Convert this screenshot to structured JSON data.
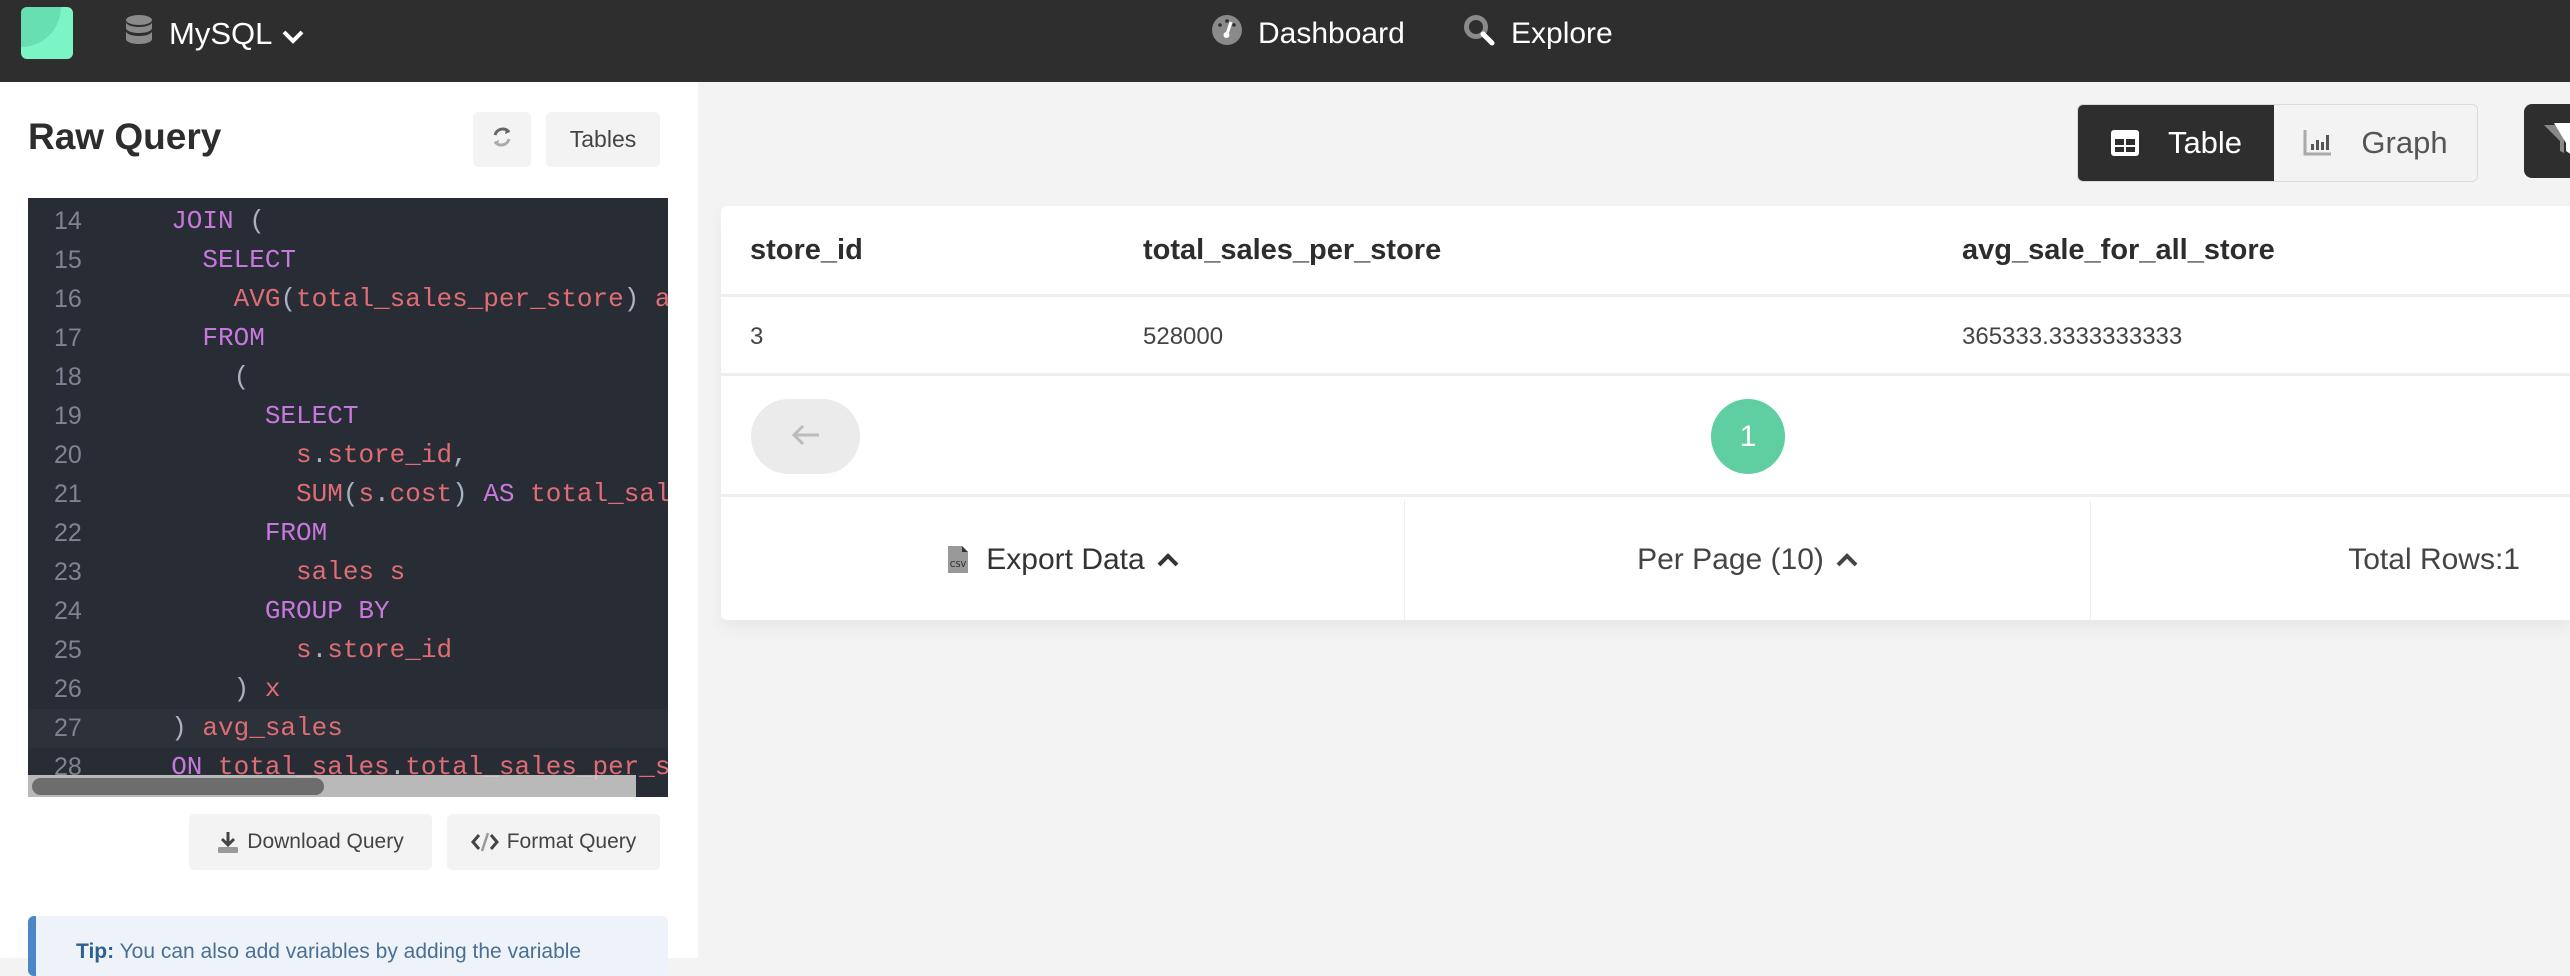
{
  "topbar": {
    "database": "MySQL",
    "nav": [
      {
        "label": "Dashboard",
        "icon": "dashboard-gauge-icon"
      },
      {
        "label": "Explore",
        "icon": "search-icon"
      }
    ]
  },
  "sidebar": {
    "title": "Raw Query",
    "tables_label": "Tables",
    "download_label": "Download Query",
    "format_label": "Format Query",
    "tip_label": "Tip:",
    "tip_text": " You can also add variables by adding the variable"
  },
  "editor": {
    "active_line": 27,
    "lines": [
      {
        "n": "14",
        "tokens": [
          [
            "kw",
            "  JOIN"
          ],
          [
            "pn",
            " ("
          ]
        ]
      },
      {
        "n": "15",
        "tokens": [
          [
            "kw",
            "    SELECT"
          ]
        ]
      },
      {
        "n": "16",
        "tokens": [
          [
            "id",
            "      AVG"
          ],
          [
            "pn",
            "("
          ],
          [
            "id",
            "total_sales_per_store"
          ],
          [
            "pn",
            ") "
          ],
          [
            "id",
            "avg_sale_for_all_store"
          ]
        ]
      },
      {
        "n": "17",
        "tokens": [
          [
            "kw",
            "    FROM"
          ]
        ]
      },
      {
        "n": "18",
        "tokens": [
          [
            "pn",
            "      ("
          ]
        ]
      },
      {
        "n": "19",
        "tokens": [
          [
            "kw",
            "        SELECT"
          ]
        ]
      },
      {
        "n": "20",
        "tokens": [
          [
            "id",
            "          s"
          ],
          [
            "pn",
            "."
          ],
          [
            "id",
            "store_id"
          ],
          [
            "pn",
            ","
          ]
        ]
      },
      {
        "n": "21",
        "tokens": [
          [
            "id",
            "          SUM"
          ],
          [
            "pn",
            "("
          ],
          [
            "id",
            "s"
          ],
          [
            "pn",
            "."
          ],
          [
            "id",
            "cost"
          ],
          [
            "pn",
            ") "
          ],
          [
            "kw",
            "AS "
          ],
          [
            "id",
            "total_sales_per_store"
          ]
        ]
      },
      {
        "n": "22",
        "tokens": [
          [
            "kw",
            "        FROM"
          ]
        ]
      },
      {
        "n": "23",
        "tokens": [
          [
            "id",
            "          sales s"
          ]
        ]
      },
      {
        "n": "24",
        "tokens": [
          [
            "kw",
            "        GROUP BY"
          ]
        ]
      },
      {
        "n": "25",
        "tokens": [
          [
            "id",
            "          s"
          ],
          [
            "pn",
            "."
          ],
          [
            "id",
            "store_id"
          ]
        ]
      },
      {
        "n": "26",
        "tokens": [
          [
            "pn",
            "      ) "
          ],
          [
            "id",
            "x"
          ]
        ]
      },
      {
        "n": "27",
        "tokens": [
          [
            "pn",
            "  ) "
          ],
          [
            "id",
            "avg_sales"
          ]
        ]
      },
      {
        "n": "28",
        "tokens": [
          [
            "kw",
            "  ON "
          ],
          [
            "id",
            "total_sales"
          ],
          [
            "pn",
            "."
          ],
          [
            "id",
            "total_sales_per_store"
          ]
        ]
      }
    ]
  },
  "view_toggle": {
    "table_label": "Table",
    "graph_label": "Graph",
    "active": "Table"
  },
  "results": {
    "columns": [
      "store_id",
      "total_sales_per_store",
      "avg_sale_for_all_store"
    ],
    "rows": [
      [
        "3",
        "528000",
        "365333.3333333333"
      ]
    ],
    "current_page": "1",
    "export_label": "Export Data",
    "per_page_label": "Per Page (10)",
    "total_rows_label": "Total Rows:1"
  },
  "colors": {
    "accent": "#5fcea0",
    "topbar": "#2e2e2e",
    "editor_bg": "#282c34"
  }
}
